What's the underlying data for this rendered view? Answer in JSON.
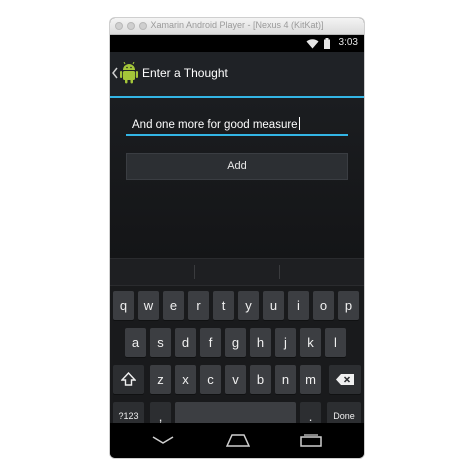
{
  "window": {
    "title": "Xamarin Android Player - [Nexus 4 (KitKat)]"
  },
  "status_bar": {
    "time": "3:03",
    "icons": [
      "wifi-icon",
      "battery-icon"
    ]
  },
  "action_bar": {
    "title": "Enter a Thought",
    "icon": "android-robot-icon"
  },
  "form": {
    "thought_value": "And one more for good measure",
    "add_label": "Add"
  },
  "keyboard": {
    "row1": [
      "q",
      "w",
      "e",
      "r",
      "t",
      "y",
      "u",
      "i",
      "o",
      "p"
    ],
    "row2": [
      "a",
      "s",
      "d",
      "f",
      "g",
      "h",
      "j",
      "k",
      "l"
    ],
    "row3": [
      "z",
      "x",
      "c",
      "v",
      "b",
      "n",
      "m"
    ],
    "row4": {
      "symbols": "?123",
      "comma": ",",
      "period": ".",
      "done": "Done"
    }
  },
  "colors": {
    "accent": "#33b5e5",
    "action_bar": "#1f2226",
    "key": "#3c3e42"
  }
}
